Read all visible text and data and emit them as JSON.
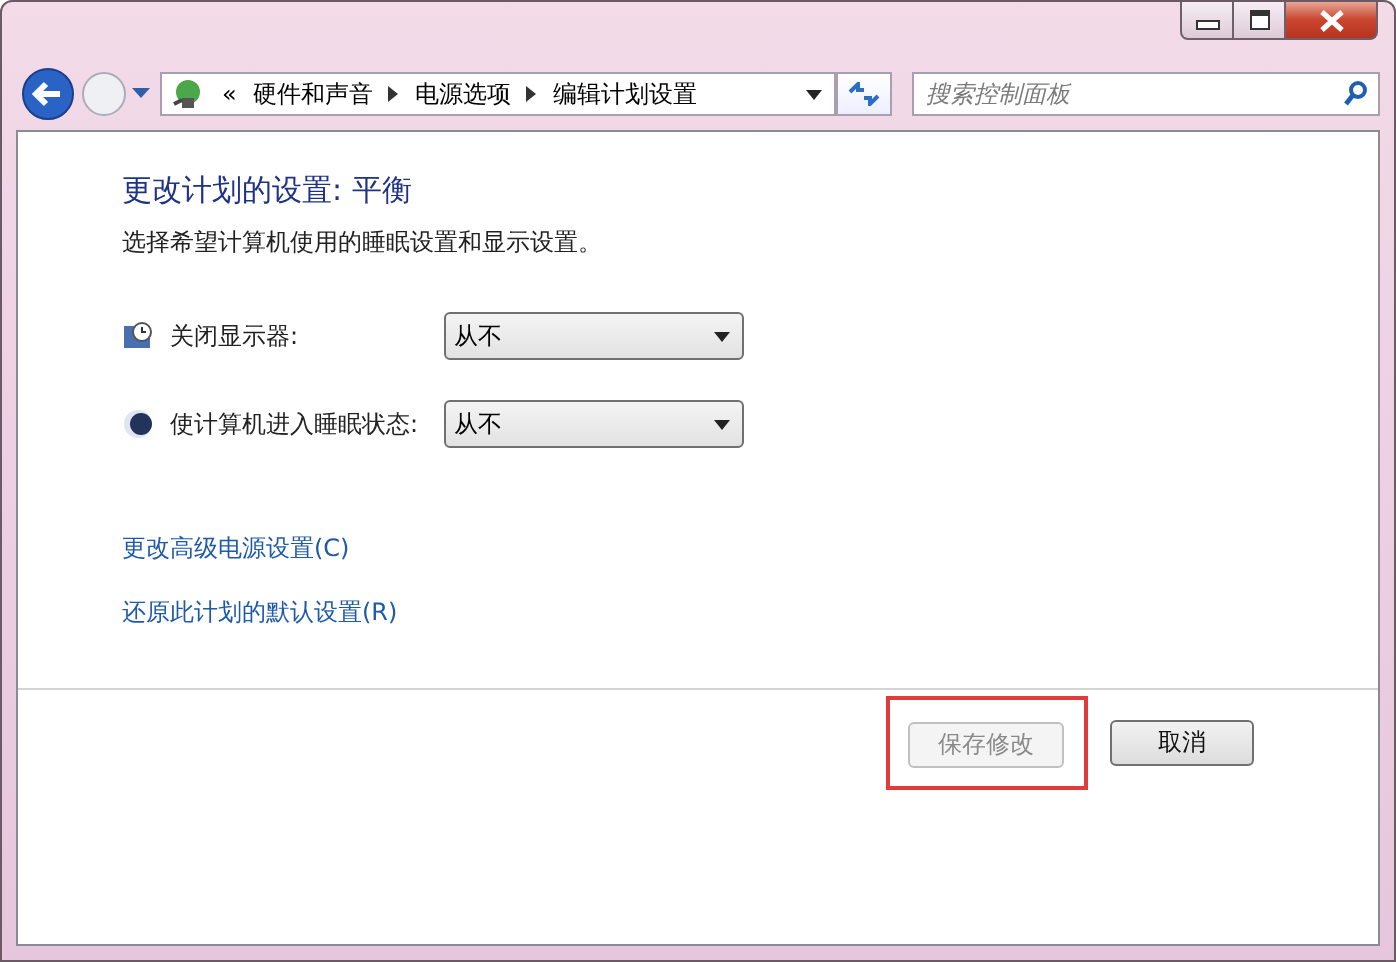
{
  "address_bar": {
    "overflow": "«",
    "crumbs": [
      "硬件和声音",
      "电源选项",
      "编辑计划设置"
    ]
  },
  "search": {
    "placeholder": "搜索控制面板"
  },
  "heading": "更改计划的设置: 平衡",
  "description": "选择希望计算机使用的睡眠设置和显示设置。",
  "settings": [
    {
      "kind": "display",
      "label": "关闭显示器:",
      "value": "从不"
    },
    {
      "kind": "sleep",
      "label": "使计算机进入睡眠状态:",
      "value": "从不"
    }
  ],
  "links": [
    "更改高级电源设置(C)",
    "还原此计划的默认设置(R)"
  ],
  "buttons": [
    {
      "label": "保存修改",
      "disabled": true,
      "highlighted": true
    },
    {
      "label": "取消",
      "disabled": false,
      "highlighted": false
    }
  ]
}
